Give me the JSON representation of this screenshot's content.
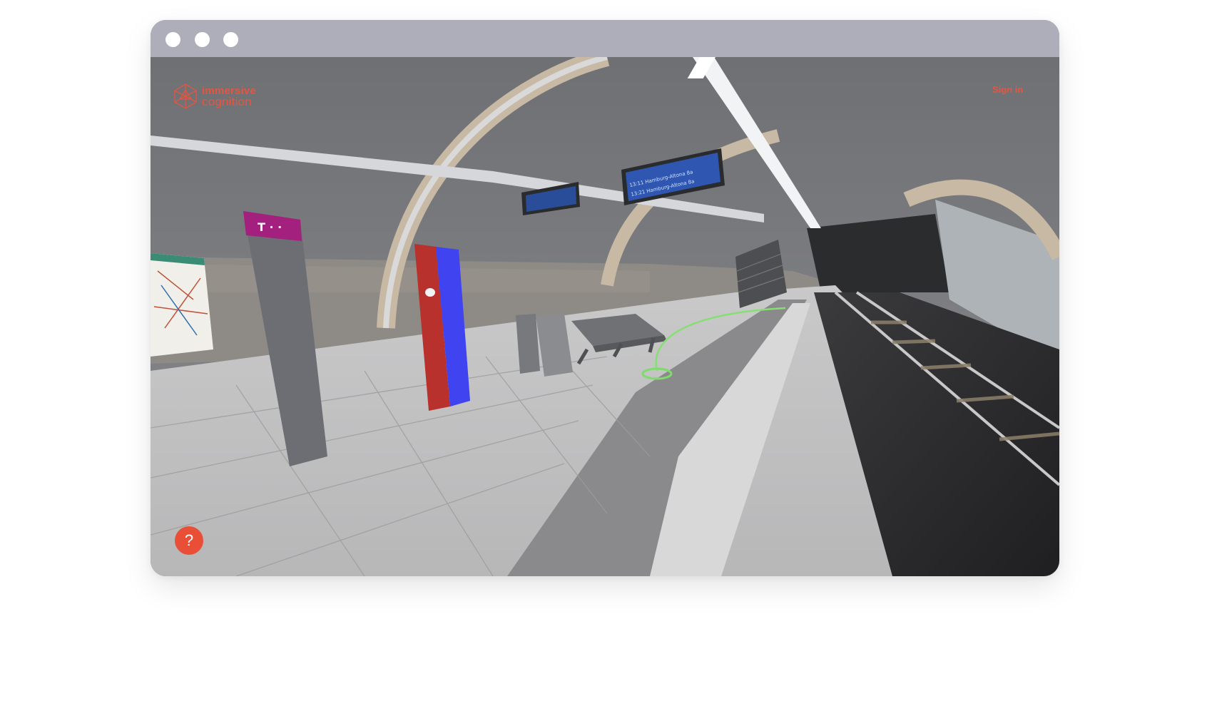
{
  "app": {
    "logo": {
      "line1": "immersive",
      "line2": "cognition",
      "icon": "network-sphere-icon"
    },
    "header": {
      "sign_in_label": "Sign in"
    },
    "help_button": {
      "label": "?"
    }
  },
  "window_controls": [
    "traffic-dot",
    "traffic-dot",
    "traffic-dot"
  ],
  "scene": {
    "pillar_brand": "T · ·",
    "departure_board_1": {
      "row1": "13:11 Hamburg-Altona 8a",
      "row2": "13:21 Hamburg-Altona 8a"
    }
  },
  "colors": {
    "accent": "#e8543f",
    "titlebar": "#aeaeba",
    "help_button": "#e94f37",
    "magenta_sign": "#a3207f",
    "target_ring": "#7ddc6a"
  }
}
